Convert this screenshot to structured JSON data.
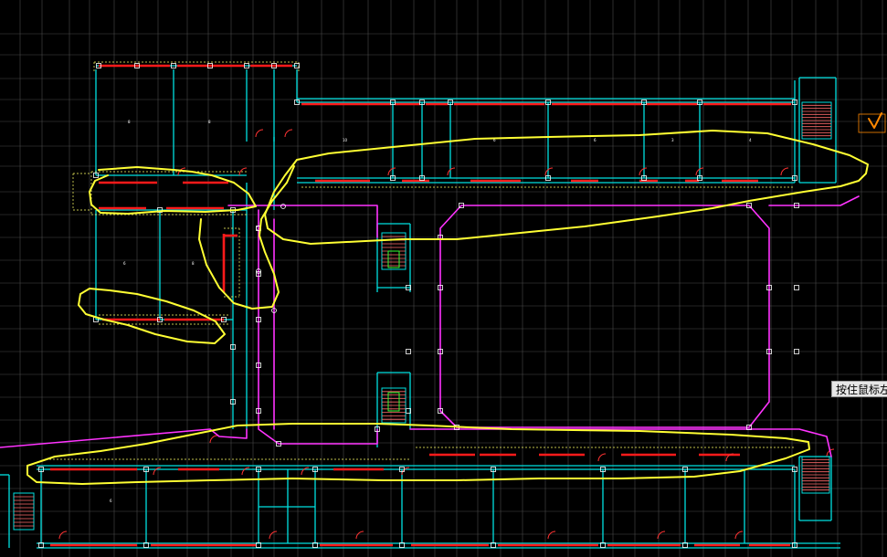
{
  "tooltip": {
    "text": "按住鼠标左"
  },
  "colors": {
    "background": "#000000",
    "grid": "#4a4a4a",
    "wall": "#00e0e0",
    "window_red": "#ff1a1a",
    "door_arc": "#ff3333",
    "corridor_magenta": "#ff33ff",
    "markup_yellow": "#ffff33",
    "column": "#ffffff",
    "dashed": "#ffff66",
    "stair": "#ff6a6a",
    "green": "#33ff33",
    "annotation_orange": "#ff8800"
  },
  "room_tags": [
    "8",
    "8",
    "10",
    "6",
    "6",
    "3",
    "4",
    "6",
    "8",
    "6"
  ]
}
